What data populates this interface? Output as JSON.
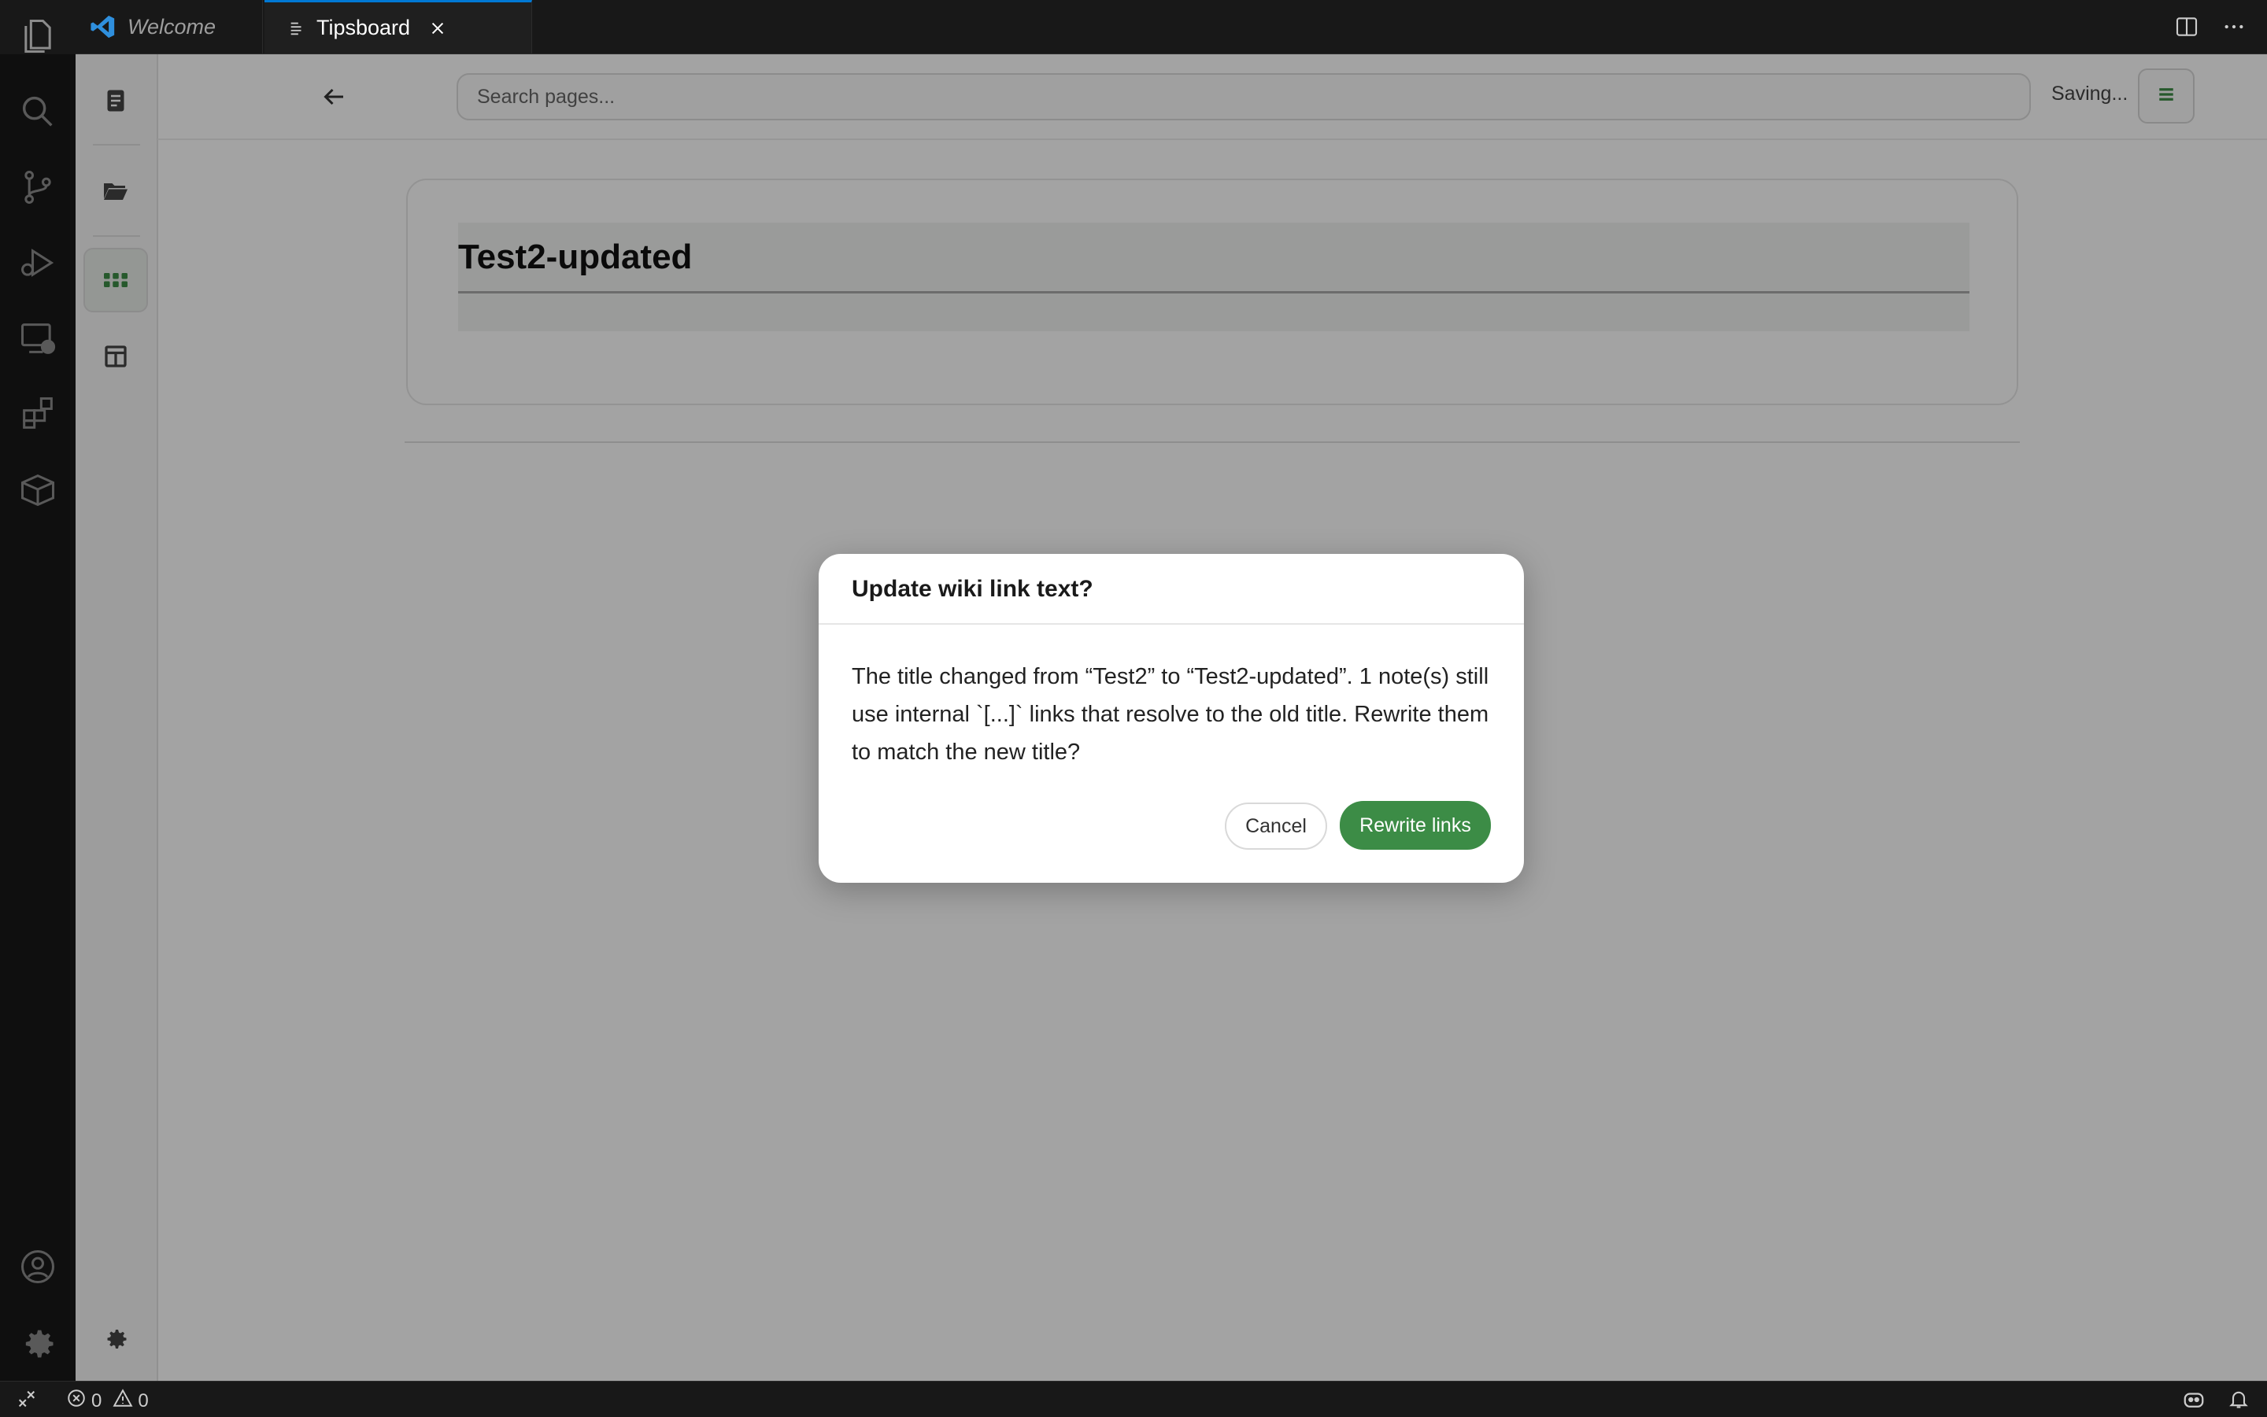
{
  "tabs": [
    {
      "label": "Welcome",
      "icon": "vscode-logo-icon"
    },
    {
      "label": "Tipsboard",
      "icon": "preview-icon"
    }
  ],
  "activity_bar": [
    "explorer-icon",
    "search-icon",
    "source-control-icon",
    "run-debug-icon",
    "remote-explorer-icon",
    "extensions-icon",
    "packages-icon",
    "account-icon",
    "manage-gear-icon"
  ],
  "rail": [
    "notebook-icon",
    "folder-icon",
    "apps-grid-icon",
    "table-icon",
    "settings-gear-icon"
  ],
  "search": {
    "placeholder": "Search pages...",
    "value": ""
  },
  "status_text": "Saving...",
  "page": {
    "title": "Test2-updated"
  },
  "dialog": {
    "title": "Update wiki link text?",
    "body": "The title changed from “Test2” to “Test2-updated”. 1 note(s) still use internal `[...]` links that resolve to the old title. Rewrite them to match the new title?",
    "cancel_label": "Cancel",
    "confirm_label": "Rewrite links"
  },
  "status_bar": {
    "errors": "0",
    "warnings": "0"
  },
  "colors": {
    "accent_green": "#3c8c46",
    "tab_active_border": "#0078d4"
  }
}
